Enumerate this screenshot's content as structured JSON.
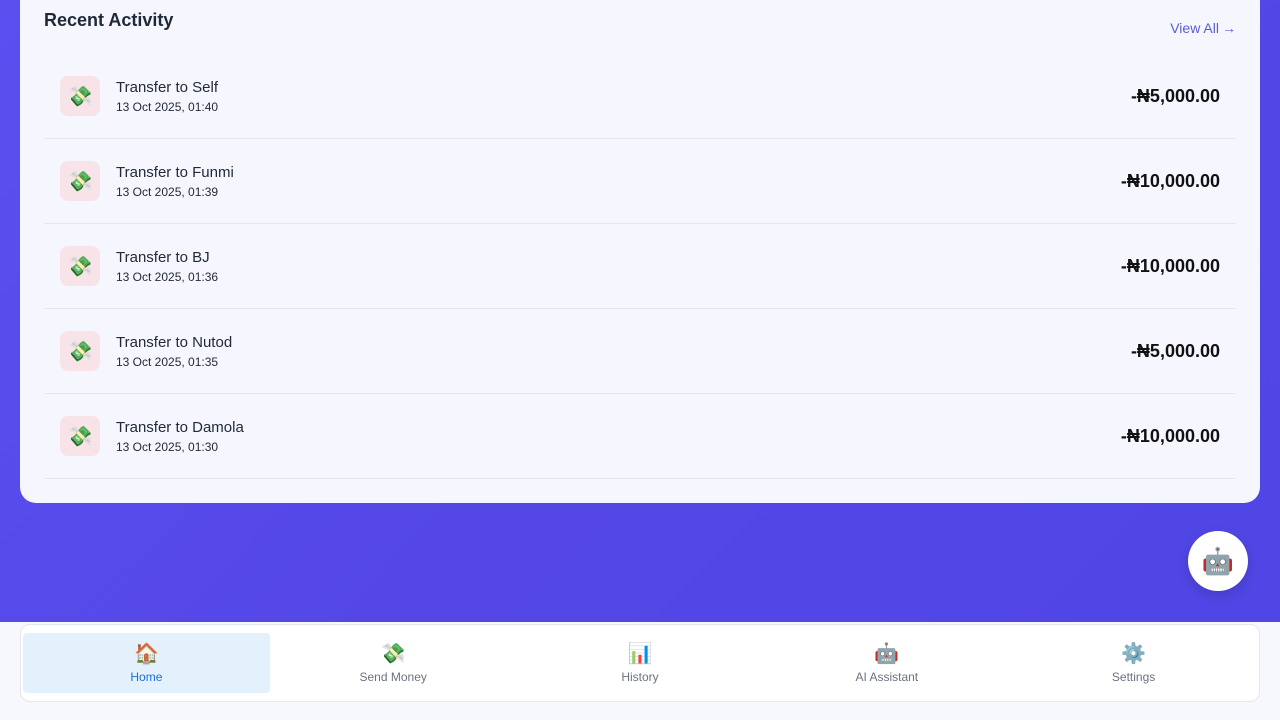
{
  "activity": {
    "title": "Recent Activity",
    "view_all": "View All",
    "view_all_arrow": "→",
    "transactions": [
      {
        "icon": "💸",
        "name": "Transfer to Self",
        "date": "13 Oct 2025, 01:40",
        "amount": "-₦5,000.00"
      },
      {
        "icon": "💸",
        "name": "Transfer to Funmi",
        "date": "13 Oct 2025, 01:39",
        "amount": "-₦10,000.00"
      },
      {
        "icon": "💸",
        "name": "Transfer to BJ",
        "date": "13 Oct 2025, 01:36",
        "amount": "-₦10,000.00"
      },
      {
        "icon": "💸",
        "name": "Transfer to Nutod",
        "date": "13 Oct 2025, 01:35",
        "amount": "-₦5,000.00"
      },
      {
        "icon": "💸",
        "name": "Transfer to Damola",
        "date": "13 Oct 2025, 01:30",
        "amount": "-₦10,000.00"
      }
    ]
  },
  "fab": {
    "icon": "🤖"
  },
  "nav": {
    "items": [
      {
        "icon": "🏠",
        "label": "Home"
      },
      {
        "icon": "💸",
        "label": "Send Money"
      },
      {
        "icon": "📊",
        "label": "History"
      },
      {
        "icon": "🤖",
        "label": "AI Assistant"
      },
      {
        "icon": "⚙️",
        "label": "Settings"
      }
    ]
  },
  "colors": {
    "background": "#5447e6",
    "accent": "#5b5bd6",
    "active_nav": "#1d6fd6"
  }
}
